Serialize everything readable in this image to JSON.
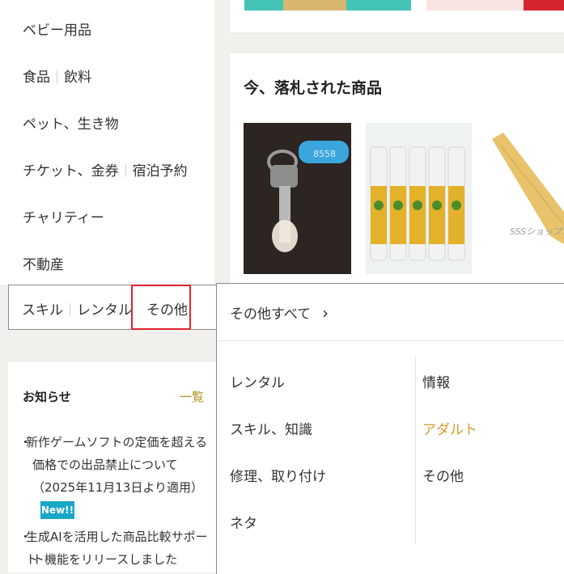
{
  "categories": {
    "baby": "ベビー用品",
    "food": "食品",
    "drink": "飲料",
    "pets": "ペット、生き物",
    "tickets": "チケット、金券",
    "lodging": "宿泊予約",
    "charity": "チャリティー",
    "realestate": "不動産",
    "skill": "スキル",
    "rental": "レンタル",
    "other": "その他"
  },
  "flyout": {
    "all_label": "その他すべて",
    "all_chevron": "›",
    "left_items": [
      "レンタル",
      "スキル、知識",
      "修理、取り付け",
      "ネタ"
    ],
    "right_items": [
      "情報",
      "アダルト",
      "その他"
    ]
  },
  "auction": {
    "title": "今、落札された商品",
    "key_tag_text": "8558",
    "thumb3_text": "SSSショップス"
  },
  "notice": {
    "title": "お知らせ",
    "more_link": "一覧",
    "items": [
      {
        "lines": [
          "新作ゲームソフトの定価を超える",
          "価格での出品禁止について",
          "（2025年11月13日より適用）"
        ],
        "badge": "New!!"
      },
      {
        "lines": [
          "生成AIを活用した商品比較サポート",
          "ト機能をリリースしました"
        ]
      }
    ]
  },
  "colors": {
    "highlight_border": "#e3232c",
    "accent_link": "#d79a2a",
    "new_badge": "#19a7c8"
  }
}
